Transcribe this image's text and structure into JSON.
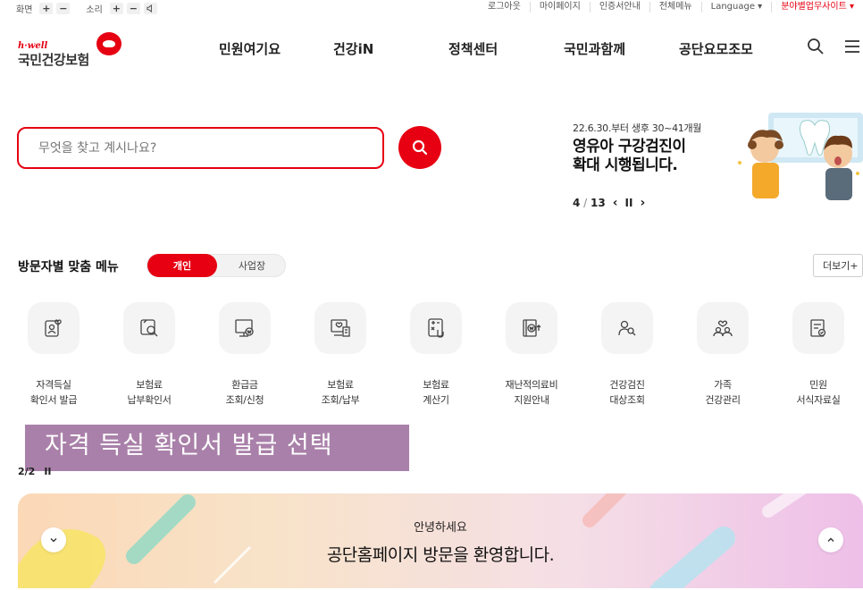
{
  "utility": {
    "screen_label": "화면",
    "sound_label": "소리",
    "plus": "+",
    "minus": "−",
    "speaker_glyph": "🔈",
    "login": "로그아웃",
    "mypage": "마이페이지",
    "cert": "인증서안내",
    "allmenu": "전체메뉴",
    "language": "Language ▾",
    "business": "분야별업무사이트 ▾"
  },
  "logo": {
    "small": "h·well",
    "name": "국민건강보험"
  },
  "gnb": [
    "민원여기요",
    "건강iN",
    "정책센터",
    "국민과함께",
    "공단요모조모"
  ],
  "search": {
    "placeholder": "무엇을 찾고 계시나요?"
  },
  "banner": {
    "date": "22.6.30.부터 생후 30~41개월",
    "title_line1": "영유아 구강검진이",
    "title_line2": "확대 시행됩니다.",
    "page_current": "4",
    "page_total": "13",
    "prev": "‹",
    "pause": "II",
    "next": "›"
  },
  "menu_section": {
    "title": "방문자별 맞춤 메뉴",
    "tab_personal": "개인",
    "tab_business": "사업장",
    "more": "더보기+",
    "items": [
      {
        "line1": "자격득실",
        "line2": "확인서 발급",
        "icon": "person-card-icon"
      },
      {
        "line1": "보험료",
        "line2": "납부확인서",
        "icon": "document-search-icon"
      },
      {
        "line1": "환급금",
        "line2": "조회/신청",
        "icon": "monitor-won-icon"
      },
      {
        "line1": "보험료",
        "line2": "조회/납부",
        "icon": "monitor-heart-icon"
      },
      {
        "line1": "보험료",
        "line2": "계산기",
        "icon": "calculator-icon"
      },
      {
        "line1": "재난적의료비",
        "line2": "지원안내",
        "icon": "won-document-icon"
      },
      {
        "line1": "건강검진",
        "line2": "대상조회",
        "icon": "people-search-icon"
      },
      {
        "line1": "가족",
        "line2": "건강관리",
        "icon": "family-heart-icon"
      },
      {
        "line1": "민원",
        "line2": "서식자료실",
        "icon": "form-check-icon"
      }
    ]
  },
  "overlay": {
    "text": "자격 득실 확인서 발급 선택"
  },
  "pager2": {
    "text": "2/2",
    "pause": "II"
  },
  "welcome": {
    "hello": "안녕하세요",
    "message": "공단홈페이지 방문을 환영합니다.",
    "down": "⌄",
    "up": "⌃"
  },
  "colors": {
    "brand": "#e60012",
    "overlay": "#9b6a9b"
  }
}
